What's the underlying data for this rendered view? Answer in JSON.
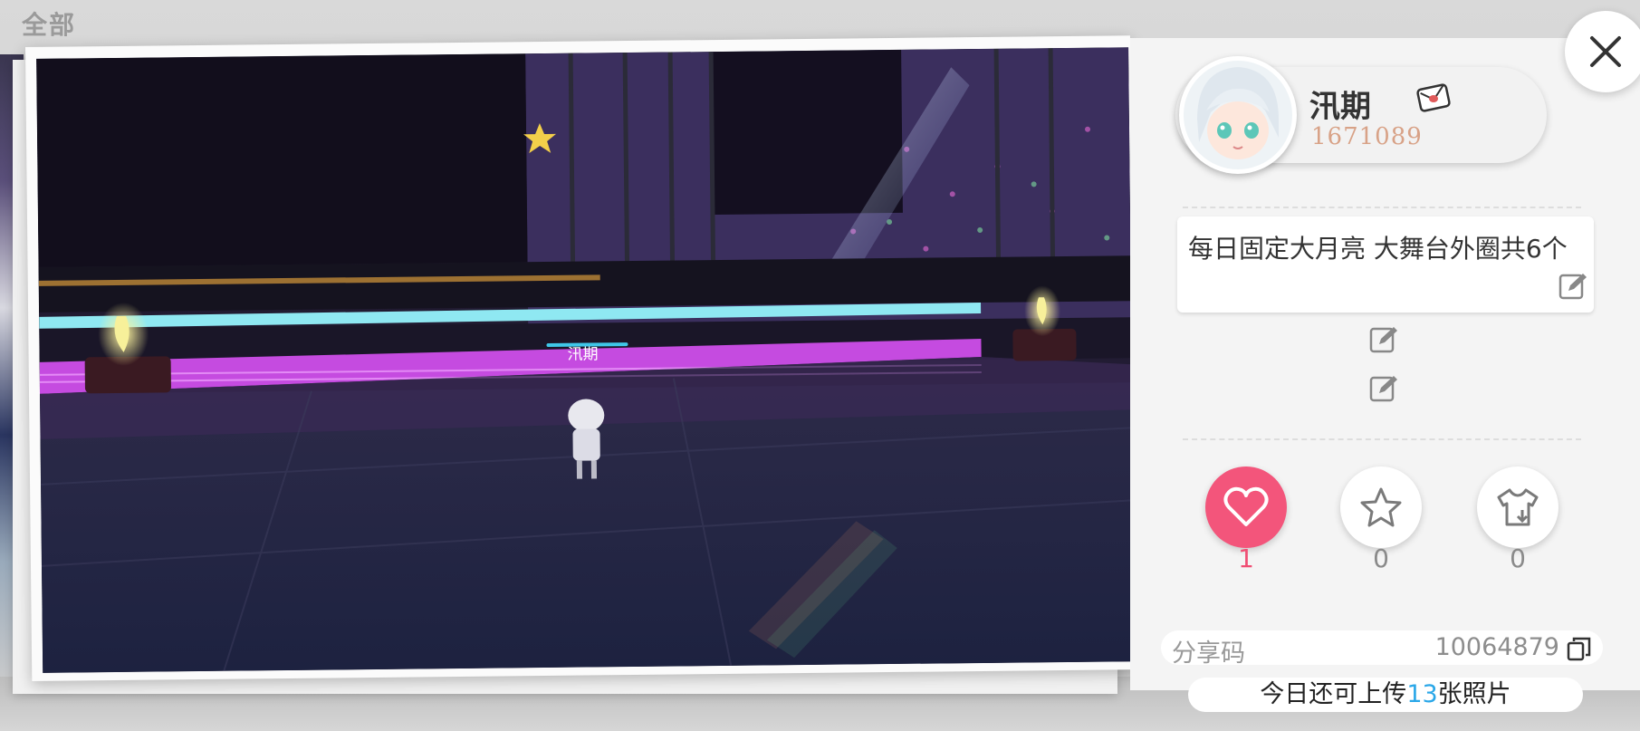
{
  "background": {
    "title": "全部"
  },
  "photo": {
    "description_tag": "screenshot-scene",
    "player_name": "汛期"
  },
  "profile": {
    "username": "汛期",
    "uid": "1671089",
    "badge_icon": "envelope-icon"
  },
  "description": {
    "text": "每日固定大月亮 大舞台外圈共6个"
  },
  "actions": {
    "like": {
      "icon": "heart-icon",
      "count": "1"
    },
    "favorite": {
      "icon": "star-icon",
      "count": "0"
    },
    "outfit": {
      "icon": "shirt-download-icon",
      "count": "0"
    }
  },
  "share": {
    "label": "分享码",
    "code": "10064879"
  },
  "upload": {
    "prefix": "今日还可上传",
    "count": "13",
    "suffix": "张照片"
  },
  "colors": {
    "like": "#f3557b",
    "uid": "#d8a287",
    "upload_count": "#2aa7e8"
  }
}
